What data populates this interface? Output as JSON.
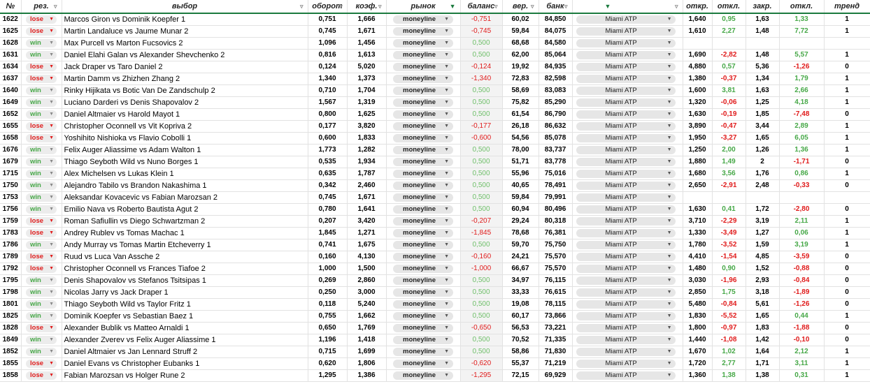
{
  "headers": {
    "num": "№",
    "result": "рез.",
    "selection": "выбор",
    "turnover": "оборот",
    "coef": "коэф.",
    "market": "рынок",
    "balance": "баланс",
    "probability": "вер.",
    "bank": "банк",
    "tournament": "",
    "open": "откр.",
    "dev1": "откл.",
    "close": "закр.",
    "dev2": "откл.",
    "trend": "тренд"
  },
  "filter_icon": "filter-funnel-icon",
  "dropdown_icon": "dropdown-arrow-icon",
  "colors": {
    "lose": "#e01b1b",
    "win": "#47a848",
    "header_rule": "#1b7a3e",
    "balance_positive": "#6fbf6a"
  },
  "rows": [
    {
      "num": "1622",
      "result": "lose",
      "selection": "Marcos Giron  vs  Dominik Koepfer 1",
      "turnover": "0,751",
      "coef": "1,666",
      "market": "moneyline",
      "balance": "-0,751",
      "probability": "60,02",
      "bank": "84,850",
      "tournament": "Miami ATP",
      "open": "1,640",
      "dev1": "0,95",
      "close": "1,63",
      "dev2": "1,33",
      "trend": "1"
    },
    {
      "num": "1625",
      "result": "lose",
      "selection": "Martin Landaluce  vs  Jaume Munar 2",
      "turnover": "0,745",
      "coef": "1,671",
      "market": "moneyline",
      "balance": "-0,745",
      "probability": "59,84",
      "bank": "84,075",
      "tournament": "Miami ATP",
      "open": "1,610",
      "dev1": "2,27",
      "close": "1,48",
      "dev2": "7,72",
      "trend": "1"
    },
    {
      "num": "1628",
      "result": "win",
      "selection": "Max Purcell  vs  Marton Fucsovics 2",
      "turnover": "1,096",
      "coef": "1,456",
      "market": "moneyline",
      "balance": "0,500",
      "probability": "68,68",
      "bank": "84,580",
      "tournament": "Miami ATP",
      "open": "",
      "dev1": "",
      "close": "",
      "dev2": "",
      "trend": ""
    },
    {
      "num": "1631",
      "result": "win",
      "selection": "Daniel Elahi Galan  vs  Alexander Shevchenko 2",
      "turnover": "0,816",
      "coef": "1,613",
      "market": "moneyline",
      "balance": "0,500",
      "probability": "62,00",
      "bank": "85,064",
      "tournament": "Miami ATP",
      "open": "1,690",
      "dev1": "-2,82",
      "close": "1,48",
      "dev2": "5,57",
      "trend": "1"
    },
    {
      "num": "1634",
      "result": "lose",
      "selection": "Jack Draper  vs  Taro Daniel 2",
      "turnover": "0,124",
      "coef": "5,020",
      "market": "moneyline",
      "balance": "-0,124",
      "probability": "19,92",
      "bank": "84,935",
      "tournament": "Miami ATP",
      "open": "4,880",
      "dev1": "0,57",
      "close": "5,36",
      "dev2": "-1,26",
      "trend": "0"
    },
    {
      "num": "1637",
      "result": "lose",
      "selection": "Martin Damm  vs  Zhizhen Zhang 2",
      "turnover": "1,340",
      "coef": "1,373",
      "market": "moneyline",
      "balance": "-1,340",
      "probability": "72,83",
      "bank": "82,598",
      "tournament": "Miami ATP",
      "open": "1,380",
      "dev1": "-0,37",
      "close": "1,34",
      "dev2": "1,79",
      "trend": "1"
    },
    {
      "num": "1640",
      "result": "win",
      "selection": "Rinky Hijikata  vs  Botic Van De Zandschulp 2",
      "turnover": "0,710",
      "coef": "1,704",
      "market": "moneyline",
      "balance": "0,500",
      "probability": "58,69",
      "bank": "83,083",
      "tournament": "Miami ATP",
      "open": "1,600",
      "dev1": "3,81",
      "close": "1,63",
      "dev2": "2,66",
      "trend": "1"
    },
    {
      "num": "1649",
      "result": "win",
      "selection": " Luciano Darderi  vs  Denis Shapovalov 2",
      "turnover": "1,567",
      "coef": "1,319",
      "market": "moneyline",
      "balance": "0,500",
      "probability": "75,82",
      "bank": "85,290",
      "tournament": "Miami ATP",
      "open": "1,320",
      "dev1": "-0,06",
      "close": "1,25",
      "dev2": "4,18",
      "trend": "1"
    },
    {
      "num": "1652",
      "result": "win",
      "selection": "Daniel Altmaier  vs  Harold Mayot 1",
      "turnover": "0,800",
      "coef": "1,625",
      "market": "moneyline",
      "balance": "0,500",
      "probability": "61,54",
      "bank": "86,790",
      "tournament": "Miami ATP",
      "open": "1,630",
      "dev1": "-0,19",
      "close": "1,85",
      "dev2": "-7,48",
      "trend": "0"
    },
    {
      "num": "1655",
      "result": "lose",
      "selection": "Christopher Oconnell  vs  Vit Kopriva 2",
      "turnover": "0,177",
      "coef": "3,820",
      "market": "moneyline",
      "balance": "-0,177",
      "probability": "26,18",
      "bank": "86,632",
      "tournament": "Miami ATP",
      "open": "3,890",
      "dev1": "-0,47",
      "close": "3,44",
      "dev2": "2,89",
      "trend": "1"
    },
    {
      "num": "1658",
      "result": "lose",
      "selection": "Yoshihito Nishioka  vs  Flavio Cobolli 1",
      "turnover": "0,600",
      "coef": "1,833",
      "market": "moneyline",
      "balance": "-0,600",
      "probability": "54,56",
      "bank": "85,078",
      "tournament": "Miami ATP",
      "open": "1,950",
      "dev1": "-3,27",
      "close": "1,65",
      "dev2": "6,05",
      "trend": "1"
    },
    {
      "num": "1676",
      "result": "win",
      "selection": " Felix Auger Aliassime  vs  Adam Walton 1",
      "turnover": "1,773",
      "coef": "1,282",
      "market": "moneyline",
      "balance": "0,500",
      "probability": "78,00",
      "bank": "83,737",
      "tournament": "Miami ATP",
      "open": "1,250",
      "dev1": "2,00",
      "close": "1,26",
      "dev2": "1,36",
      "trend": "1"
    },
    {
      "num": "1679",
      "result": "win",
      "selection": "Thiago Seyboth Wild  vs  Nuno Borges 1",
      "turnover": "0,535",
      "coef": "1,934",
      "market": "moneyline",
      "balance": "0,500",
      "probability": "51,71",
      "bank": "83,778",
      "tournament": "Miami ATP",
      "open": "1,880",
      "dev1": "1,49",
      "close": "2",
      "dev2": "-1,71",
      "trend": "0"
    },
    {
      "num": "1715",
      "result": "win",
      "selection": "Alex Michelsen  vs  Lukas Klein 1",
      "turnover": "0,635",
      "coef": "1,787",
      "market": "moneyline",
      "balance": "0,500",
      "probability": "55,96",
      "bank": "75,016",
      "tournament": "Miami ATP",
      "open": "1,680",
      "dev1": "3,56",
      "close": "1,76",
      "dev2": "0,86",
      "trend": "1"
    },
    {
      "num": "1750",
      "result": "win",
      "selection": "Alejandro Tabilo  vs  Brandon Nakashima 1",
      "turnover": "0,342",
      "coef": "2,460",
      "market": "moneyline",
      "balance": "0,500",
      "probability": "40,65",
      "bank": "78,491",
      "tournament": "Miami ATP",
      "open": "2,650",
      "dev1": "-2,91",
      "close": "2,48",
      "dev2": "-0,33",
      "trend": "0"
    },
    {
      "num": "1753",
      "result": "win",
      "selection": "Aleksandar Kovacevic  vs  Fabian Marozsan 2",
      "turnover": "0,745",
      "coef": "1,671",
      "market": "moneyline",
      "balance": "0,500",
      "probability": "59,84",
      "bank": "79,991",
      "tournament": "Miami ATP",
      "open": "",
      "dev1": "",
      "close": "",
      "dev2": "",
      "trend": ""
    },
    {
      "num": "1756",
      "result": "win",
      "selection": "Emilio Nava  vs  Roberto Bautista Agut 2",
      "turnover": "0,780",
      "coef": "1,641",
      "market": "moneyline",
      "balance": "0,500",
      "probability": "60,94",
      "bank": "80,496",
      "tournament": "Miami ATP",
      "open": "1,630",
      "dev1": "0,41",
      "close": "1,72",
      "dev2": "-2,80",
      "trend": "0"
    },
    {
      "num": "1759",
      "result": "lose",
      "selection": "Roman Safiullin  vs  Diego Schwartzman 2",
      "turnover": "0,207",
      "coef": "3,420",
      "market": "moneyline",
      "balance": "-0,207",
      "probability": "29,24",
      "bank": "80,318",
      "tournament": "Miami ATP",
      "open": "3,710",
      "dev1": "-2,29",
      "close": "3,19",
      "dev2": "2,11",
      "trend": "1"
    },
    {
      "num": "1783",
      "result": "lose",
      "selection": "Andrey Rublev  vs  Tomas Machac 1",
      "turnover": "1,845",
      "coef": "1,271",
      "market": "moneyline",
      "balance": "-1,845",
      "probability": "78,68",
      "bank": "76,381",
      "tournament": "Miami ATP",
      "open": "1,330",
      "dev1": "-3,49",
      "close": "1,27",
      "dev2": "0,06",
      "trend": "1"
    },
    {
      "num": "1786",
      "result": "win",
      "selection": "Andy Murray  vs  Tomas Martin Etcheverry 1",
      "turnover": "0,741",
      "coef": "1,675",
      "market": "moneyline",
      "balance": "0,500",
      "probability": "59,70",
      "bank": "75,750",
      "tournament": "Miami ATP",
      "open": "1,780",
      "dev1": "-3,52",
      "close": "1,59",
      "dev2": "3,19",
      "trend": "1"
    },
    {
      "num": "1789",
      "result": "lose",
      "selection": "Ruud  vs  Luca Van Assche 2",
      "turnover": "0,160",
      "coef": "4,130",
      "market": "moneyline",
      "balance": "-0,160",
      "probability": "24,21",
      "bank": "75,570",
      "tournament": "Miami ATP",
      "open": "4,410",
      "dev1": "-1,54",
      "close": "4,85",
      "dev2": "-3,59",
      "trend": "0"
    },
    {
      "num": "1792",
      "result": "lose",
      "selection": "Christopher Oconnell  vs  Frances Tiafoe 2",
      "turnover": "1,000",
      "coef": "1,500",
      "market": "moneyline",
      "balance": "-1,000",
      "probability": "66,67",
      "bank": "75,570",
      "tournament": "Miami ATP",
      "open": "1,480",
      "dev1": "0,90",
      "close": "1,52",
      "dev2": "-0,88",
      "trend": "0"
    },
    {
      "num": "1795",
      "result": "win",
      "selection": "Denis Shapovalov  vs  Stefanos Tsitsipas 1",
      "turnover": "0,269",
      "coef": "2,860",
      "market": "moneyline",
      "balance": "0,500",
      "probability": "34,97",
      "bank": "76,115",
      "tournament": "Miami ATP",
      "open": "3,030",
      "dev1": "-1,96",
      "close": "2,93",
      "dev2": "-0,84",
      "trend": "0"
    },
    {
      "num": "1798",
      "result": "win",
      "selection": "Nicolas Jarry  vs  Jack Draper 1",
      "turnover": "0,250",
      "coef": "3,000",
      "market": "moneyline",
      "balance": "0,500",
      "probability": "33,33",
      "bank": "76,615",
      "tournament": "Miami ATP",
      "open": "2,850",
      "dev1": "1,75",
      "close": "3,18",
      "dev2": "-1,89",
      "trend": "0"
    },
    {
      "num": "1801",
      "result": "win",
      "selection": "Thiago Seyboth Wild  vs  Taylor Fritz 1",
      "turnover": "0,118",
      "coef": "5,240",
      "market": "moneyline",
      "balance": "0,500",
      "probability": "19,08",
      "bank": "78,115",
      "tournament": "Miami ATP",
      "open": "5,480",
      "dev1": "-0,84",
      "close": "5,61",
      "dev2": "-1,26",
      "trend": "0"
    },
    {
      "num": "1825",
      "result": "win",
      "selection": "Dominik Koepfer  vs  Sebastian Baez 1",
      "turnover": "0,755",
      "coef": "1,662",
      "market": "moneyline",
      "balance": "0,500",
      "probability": "60,17",
      "bank": "73,866",
      "tournament": "Miami ATP",
      "open": "1,830",
      "dev1": "-5,52",
      "close": "1,65",
      "dev2": "0,44",
      "trend": "1"
    },
    {
      "num": "1828",
      "result": "lose",
      "selection": "Alexander Bublik  vs  Matteo Arnaldi 1",
      "turnover": "0,650",
      "coef": "1,769",
      "market": "moneyline",
      "balance": "-0,650",
      "probability": "56,53",
      "bank": "73,221",
      "tournament": "Miami ATP",
      "open": "1,800",
      "dev1": "-0,97",
      "close": "1,83",
      "dev2": "-1,88",
      "trend": "0"
    },
    {
      "num": "1849",
      "result": "win",
      "selection": "Alexander Zverev  vs  Felix Auger Aliassime 1",
      "turnover": "1,196",
      "coef": "1,418",
      "market": "moneyline",
      "balance": "0,500",
      "probability": "70,52",
      "bank": "71,335",
      "tournament": "Miami ATP",
      "open": "1,440",
      "dev1": "-1,08",
      "close": "1,42",
      "dev2": "-0,10",
      "trend": "0"
    },
    {
      "num": "1852",
      "result": "win",
      "selection": "Daniel Altmaier  vs  Jan Lennard Struff 2",
      "turnover": "0,715",
      "coef": "1,699",
      "market": "moneyline",
      "balance": "0,500",
      "probability": "58,86",
      "bank": "71,830",
      "tournament": "Miami ATP",
      "open": "1,670",
      "dev1": "1,02",
      "close": "1,64",
      "dev2": "2,12",
      "trend": "1"
    },
    {
      "num": "1855",
      "result": "lose",
      "selection": "Daniel Evans  vs  Christopher Eubanks 1",
      "turnover": "0,620",
      "coef": "1,806",
      "market": "moneyline",
      "balance": "-0,620",
      "probability": "55,37",
      "bank": "71,219",
      "tournament": "Miami ATP",
      "open": "1,720",
      "dev1": "2,77",
      "close": "1,71",
      "dev2": "3,11",
      "trend": "1"
    },
    {
      "num": "1858",
      "result": "lose",
      "selection": "Fabian Marozsan  vs  Holger Rune 2",
      "turnover": "1,295",
      "coef": "1,386",
      "market": "moneyline",
      "balance": "-1,295",
      "probability": "72,15",
      "bank": "69,929",
      "tournament": "Miami ATP",
      "open": "1,360",
      "dev1": "1,38",
      "close": "1,38",
      "dev2": "0,31",
      "trend": "1"
    }
  ]
}
